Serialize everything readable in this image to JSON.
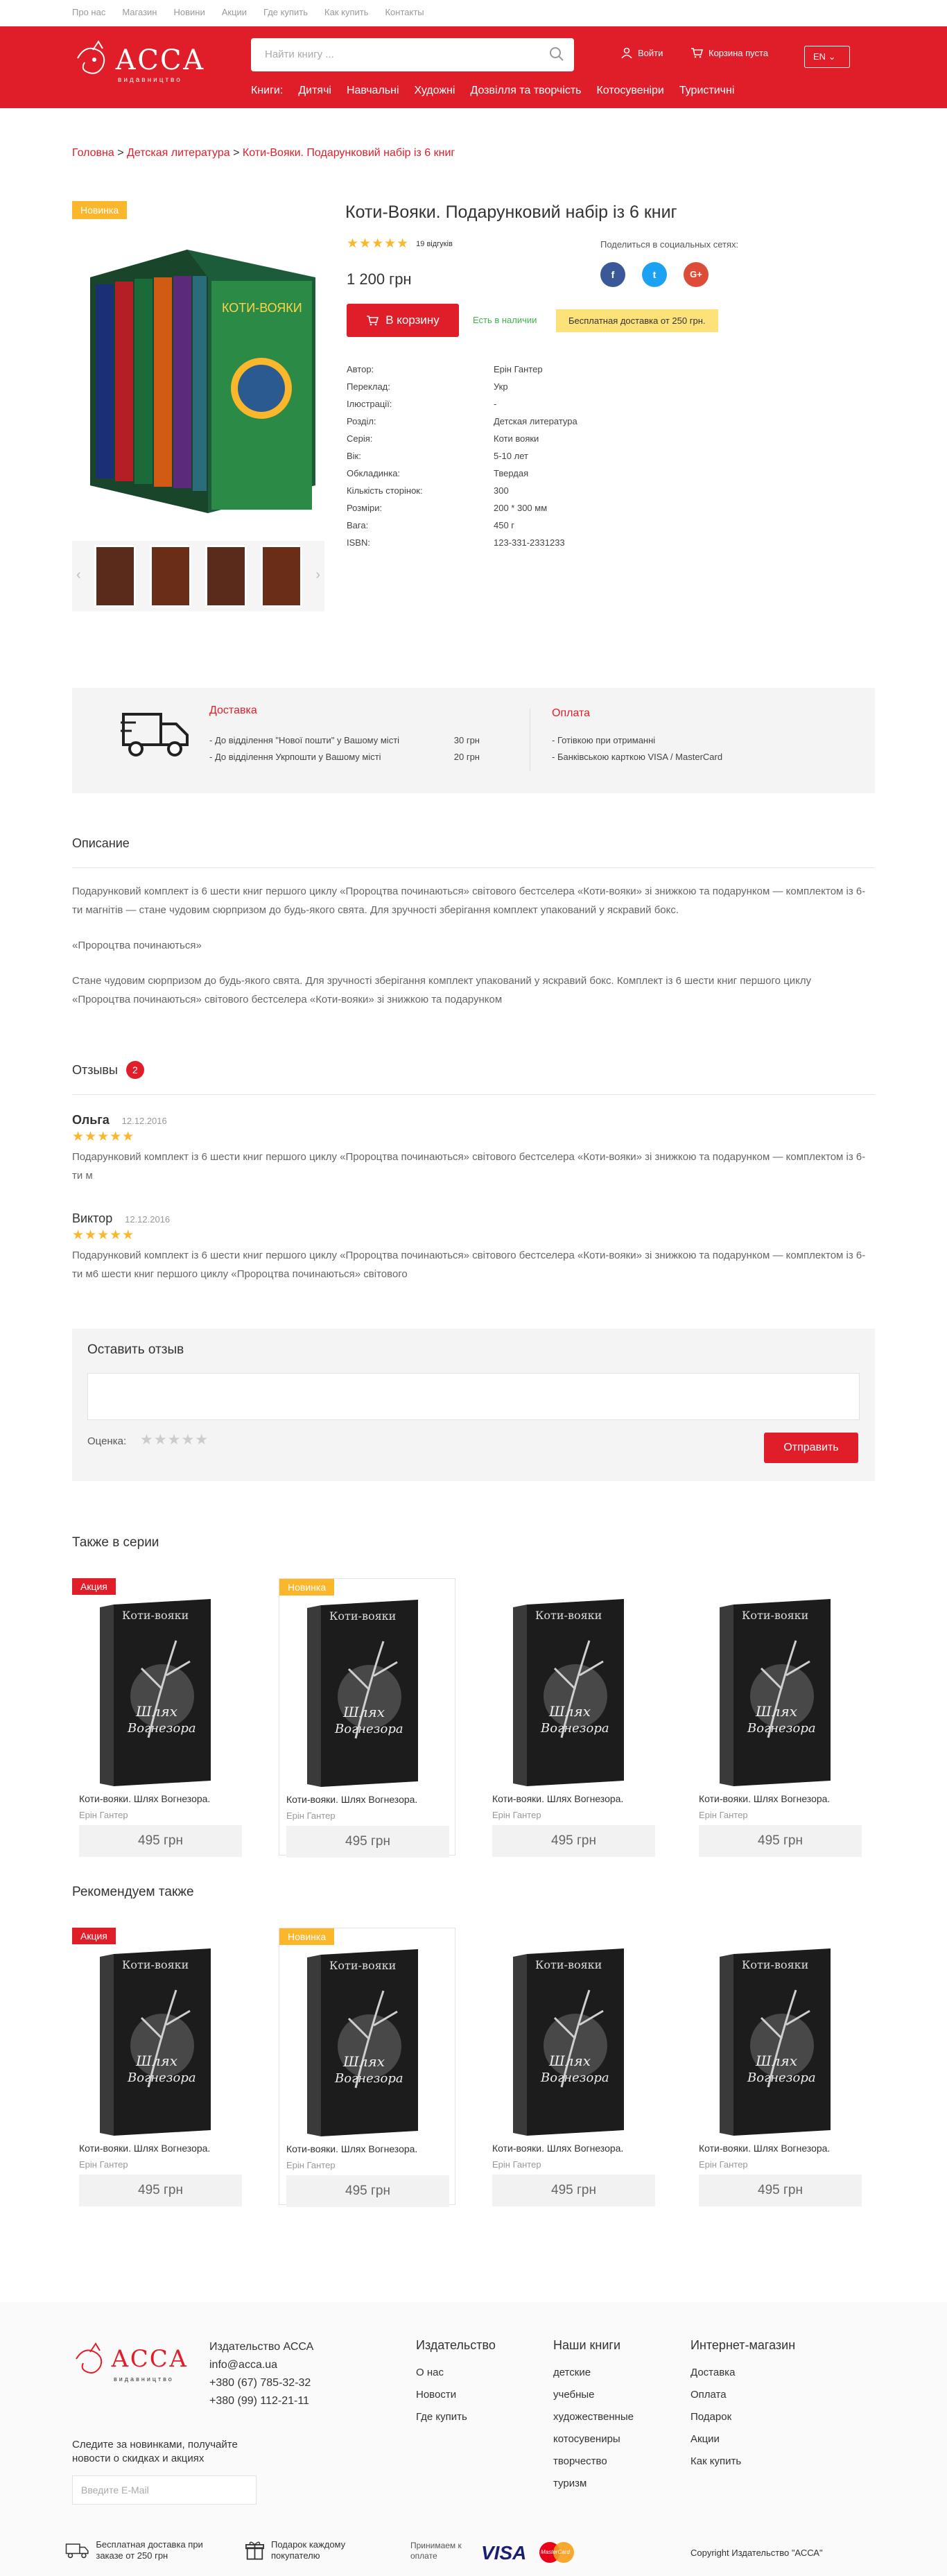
{
  "topbar": {
    "links": [
      "Про нас",
      "Магазин",
      "Новини",
      "Акции",
      "Где купить",
      "Как купить",
      "Контакты"
    ]
  },
  "header": {
    "logo_text": "АССА",
    "logo_sub": "видавництво",
    "search_placeholder": "Найти книгу ...",
    "login": "Войти",
    "cart": "Корзина пуста",
    "lang": "EN",
    "nav": [
      "Книги:",
      "Дитячі",
      "Навчальні",
      "Художні",
      "Дозвілля та творчість",
      "Котосувеніри",
      "Туристичні"
    ]
  },
  "breadcrumb": {
    "items": [
      "Головна",
      "Детская литература",
      "Коти-Вояки. Подарунковий набір із 6 книг"
    ]
  },
  "product": {
    "badge": "Новинка",
    "title": "Коти-Вояки. Подарунковий набір із 6 книг",
    "rating": 5,
    "reviews_count": "19 відгуків",
    "share_label": "Поделиться в социальных сетях:",
    "price": "1 200 грн",
    "cart_button": "В корзину",
    "stock": "Есть в наличии",
    "free_delivery": "Бесплатная доставка от 250 грн.",
    "specs": [
      {
        "k": "Автор:",
        "v": "Ерін Гантер"
      },
      {
        "k": "Переклад:",
        "v": "Укр"
      },
      {
        "k": "Ілюстрації:",
        "v": "-"
      },
      {
        "k": "Розділ:",
        "v": "Детская литература"
      },
      {
        "k": "Серія:",
        "v": "Коти вояки"
      },
      {
        "k": "Вік:",
        "v": "5-10 лет"
      },
      {
        "k": "Обкладинка:",
        "v": "Твердая"
      },
      {
        "k": "Кількість сторінок:",
        "v": "300"
      },
      {
        "k": "Розміри:",
        "v": "200 * 300 мм"
      },
      {
        "k": "Вага:",
        "v": "450 г"
      },
      {
        "k": "ISBN:",
        "v": "123-331-2331233"
      }
    ]
  },
  "delivery": {
    "title": "Доставка",
    "rows": [
      {
        "label": "- До відділення \"Нової пошти\" у Вашому місті",
        "price": "30 грн"
      },
      {
        "label": "- До відділення Укрпошти у Вашому місті",
        "price": "20 грн"
      }
    ],
    "pay_title": "Оплата",
    "pay_rows": [
      "- Готівкою при отриманні",
      "- Банківською карткою VISA / MasterCard"
    ]
  },
  "description": {
    "title": "Описание",
    "p1": "Подарунковий комплект із 6 шести книг першого циклу «Пророцтва починаються» світового бестселера «Коти-вояки» зі знижкою та подарунком — комплектом із 6-ти магнітів — стане чудовим сюрпризом до будь-якого свята. Для зручності зберігання комплект упакований у яскравий бокс.",
    "p2": "«Пророцтва починаються»",
    "p3": "Стане чудовим сюрпризом до будь-якого свята. Для зручності зберігання комплект упакований у яскравий бокс. Комплект із 6 шести книг першого циклу «Пророцтва починаються» світового бестселера «Коти-вояки» зі знижкою та подарунком"
  },
  "reviews": {
    "title": "Отзывы",
    "count": "2",
    "items": [
      {
        "name": "Ольга",
        "date": "12.12.2016",
        "text": "Подарунковий комплект із 6 шести книг першого циклу «Пророцтва починаються» світового бестселера «Коти-вояки» зі знижкою та подарунком — комплектом із 6-ти м"
      },
      {
        "name": "Виктор",
        "date": "12.12.2016",
        "text": "Подарунковий комплект із 6 шести книг першого циклу «Пророцтва починаються» світового бестселера «Коти-вояки» зі знижкою та подарунком — комплектом із 6-ти м6 шести книг першого циклу «Пророцтва починаються» світового"
      }
    ],
    "form_title": "Оставить отзыв",
    "rating_label": "Оценка:",
    "submit": "Отправить"
  },
  "series": {
    "title": "Также в серии",
    "items": [
      {
        "badge": "Акция",
        "badge_type": "sale",
        "name": "Коти-вояки. Шлях Вогнезора.",
        "author": "Ерін Гантер",
        "price": "495 грн"
      },
      {
        "badge": "Новинка",
        "badge_type": "new",
        "name": "Коти-вояки. Шлях Вогнезора.",
        "author": "Ерін Гантер",
        "price": "495 грн"
      },
      {
        "badge": "",
        "badge_type": "",
        "name": "Коти-вояки. Шлях Вогнезора.",
        "author": "Ерін Гантер",
        "price": "495 грн"
      },
      {
        "badge": "",
        "badge_type": "",
        "name": "Коти-вояки. Шлях Вогнезора.",
        "author": "Ерін Гантер",
        "price": "495 грн"
      }
    ]
  },
  "recommended": {
    "title": "Рекомендуем также",
    "items": [
      {
        "badge": "Акция",
        "badge_type": "sale",
        "name": "Коти-вояки. Шлях Вогнезора.",
        "author": "Ерін Гантер",
        "price": "495 грн"
      },
      {
        "badge": "Новинка",
        "badge_type": "new",
        "name": "Коти-вояки. Шлях Вогнезора.",
        "author": "Ерін Гантер",
        "price": "495 грн"
      },
      {
        "badge": "",
        "badge_type": "",
        "name": "Коти-вояки. Шлях Вогнезора.",
        "author": "Ерін Гантер",
        "price": "495 грн"
      },
      {
        "badge": "",
        "badge_type": "",
        "name": "Коти-вояки. Шлях Вогнезора.",
        "author": "Ерін Гантер",
        "price": "495 грн"
      }
    ]
  },
  "book_cover": {
    "series": "Коти-вояки",
    "title1": "Шлях",
    "title2": "Вогнезора",
    "author": "Ерін Гантер"
  },
  "footer": {
    "company": "Издательство АССА",
    "email": "info@acca.ua",
    "phone1": "+380 (67) 785-32-32",
    "phone2": "+380 (99) 112-21-11",
    "subscribe_text": "Следите за новинками, получайте новости о скидках и акциях",
    "email_placeholder": "Введите E-Mail",
    "col1": {
      "title": "Издательство",
      "links": [
        "О нас",
        "Новости",
        "Где купить"
      ]
    },
    "col2": {
      "title": "Наши книги",
      "links": [
        "детские",
        "учебные",
        "художественные",
        "котосувениры",
        "творчество",
        "туризм"
      ]
    },
    "col3": {
      "title": "Интернет-магазин",
      "links": [
        "Доставка",
        "Оплата",
        "Подарок",
        "Акции",
        "Как купить"
      ]
    },
    "perk1": "Бесплатная доставка при заказе от 250 грн",
    "perk2": "Подарок каждому покупателю",
    "accept": "Принимаем к оплате",
    "visa": "VISA",
    "mc": "MasterCard",
    "copyright": "Copyright Издательство \"АССА\""
  }
}
